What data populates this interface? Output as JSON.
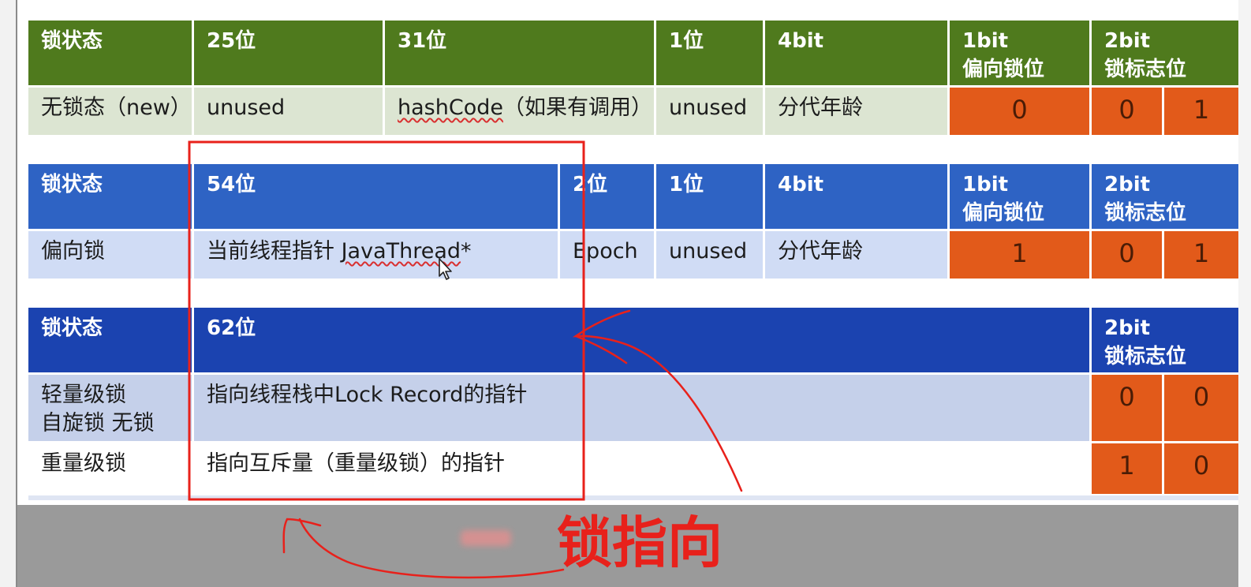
{
  "annotation": {
    "caption": "锁指向",
    "stroke_color": "#e8211b"
  },
  "colors": {
    "green_header": "#4f7a1d",
    "blue_header": "#2e63c4",
    "navy_header": "#1b43b0",
    "orange_bits": "#e25a1a"
  },
  "icons": {
    "cursor": "mouse-pointer-icon"
  },
  "table_unlocked": {
    "header": [
      "锁状态",
      "25位",
      "31位",
      "1位",
      "4bit",
      "1bit",
      "偏向锁位",
      "2bit",
      "锁标志位"
    ],
    "row": {
      "state": "无锁态（new）",
      "c25": "unused",
      "hash_prefix": "hashCode",
      "hash_suffix": "（如果有调用）",
      "c1": "unused",
      "age": "分代年龄",
      "biased_bit": "0",
      "flag1": "0",
      "flag2": "1"
    }
  },
  "table_biased": {
    "header": [
      "锁状态",
      "54位",
      "2位",
      "1位",
      "4bit",
      "1bit",
      "偏向锁位",
      "2bit",
      "锁标志位"
    ],
    "row": {
      "state": "偏向锁",
      "thread_prefix": "当前线程指针 ",
      "thread_word": "JavaThread",
      "thread_suffix": "*",
      "epoch": "Epoch",
      "c1": "unused",
      "age": "分代年龄",
      "biased_bit": "1",
      "flag1": "0",
      "flag2": "1"
    }
  },
  "table_locked": {
    "header": [
      "锁状态",
      "62位",
      "2bit",
      "锁标志位"
    ],
    "rows": [
      {
        "state_line1": "轻量级锁",
        "state_line2": "自旋锁 无锁",
        "pointer": "指向线程栈中Lock Record的指针",
        "flag1": "0",
        "flag2": "0"
      },
      {
        "state_line1": "重量级锁",
        "pointer": "指向互斥量（重量级锁）的指针",
        "flag1": "1",
        "flag2": "0"
      }
    ]
  }
}
